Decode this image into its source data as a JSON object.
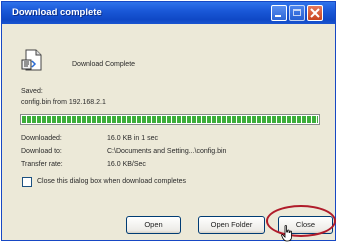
{
  "window": {
    "title": "Download complete",
    "title_color": "#1a58d8",
    "controls": [
      "minimize-icon",
      "maximize-icon",
      "close-icon"
    ]
  },
  "header": {
    "label": "Download Complete",
    "icon": "file-icon"
  },
  "saved": {
    "label": "Saved:",
    "file": "config.bin from 192.168.2.1"
  },
  "progress": {
    "percent": 100,
    "color": "#3dae3a"
  },
  "details": [
    {
      "label": "Downloaded:",
      "value": "16.0 KB in 1 sec"
    },
    {
      "label": "Download to:",
      "value": "C:\\Documents and Setting...\\config.bin"
    },
    {
      "label": "Transfer rate:",
      "value": "16.0 KB/Sec"
    }
  ],
  "options": {
    "close_on_complete_label": "Close this dialog box when download completes",
    "close_on_complete_checked": false
  },
  "buttons": {
    "open": "Open",
    "open_folder": "Open Folder",
    "close": "Close"
  },
  "annotation": {
    "highlight_color": "#b01c2a",
    "cursor": "pointer-hand-icon"
  }
}
